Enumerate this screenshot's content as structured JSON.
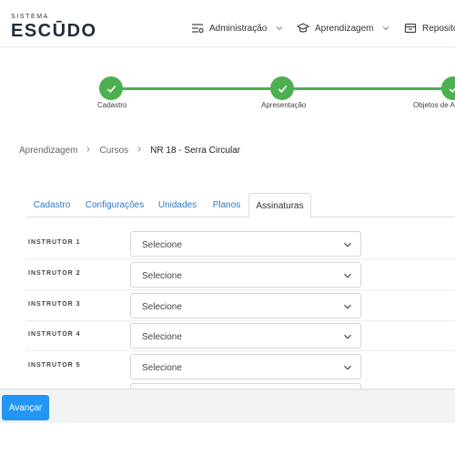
{
  "brand": {
    "top": "SISTEMA",
    "main": "ESCŪDO"
  },
  "nav": {
    "items": [
      {
        "label": "Administração",
        "icon": "settings-list-icon"
      },
      {
        "label": "Aprendizagem",
        "icon": "graduation-cap-icon"
      },
      {
        "label": "Repositó",
        "icon": "repository-icon"
      }
    ]
  },
  "stepper": {
    "steps": [
      {
        "label": "Cadastro",
        "status": "done"
      },
      {
        "label": "Apresentação",
        "status": "done"
      },
      {
        "label": "Objetos de Ap",
        "status": "done"
      }
    ],
    "color": "#4caf50"
  },
  "breadcrumb": {
    "items": [
      "Aprendizagem",
      "Cursos",
      "NR 18 - Serra Circular"
    ]
  },
  "tabs": {
    "items": [
      "Cadastro",
      "Configurações",
      "Unidades",
      "Planos",
      "Assinaturas"
    ],
    "active": "Assinaturas"
  },
  "instructors": [
    {
      "label": "INSTRUTOR 1",
      "value": "Selecione"
    },
    {
      "label": "INSTRUTOR 2",
      "value": "Selecione"
    },
    {
      "label": "INSTRUTOR 3",
      "value": "Selecione"
    },
    {
      "label": "INSTRUTOR 4",
      "value": "Selecione"
    },
    {
      "label": "INSTRUTOR 5",
      "value": "Selecione"
    }
  ],
  "footer": {
    "next_label": "Avançar"
  },
  "colors": {
    "accent": "#2196f3",
    "link": "#2a7ac7",
    "success": "#4caf50"
  }
}
